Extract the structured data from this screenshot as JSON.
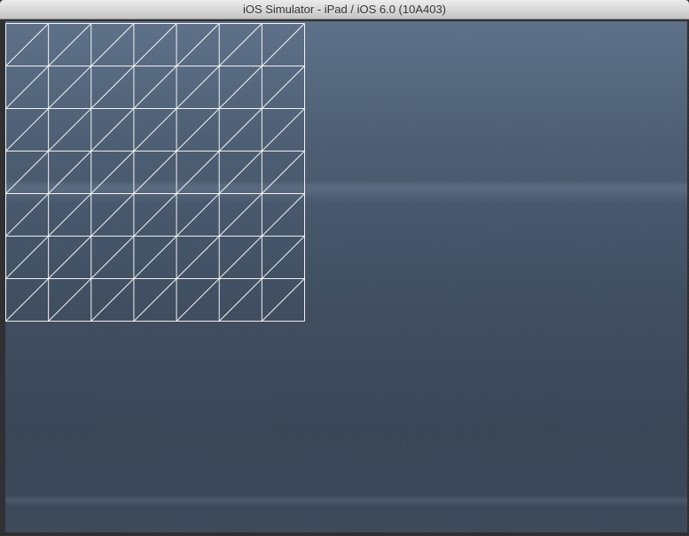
{
  "window": {
    "title": "iOS Simulator - iPad / iOS 6.0 (10A403)"
  },
  "mesh": {
    "rows": 7,
    "cols": 7,
    "line_color": "#ffffff",
    "diagonal": "bottom-left-to-top-right"
  },
  "colors": {
    "background_top": "#5e7189",
    "background_bottom": "#3c4859",
    "titlebar": "#d6d6d6"
  }
}
